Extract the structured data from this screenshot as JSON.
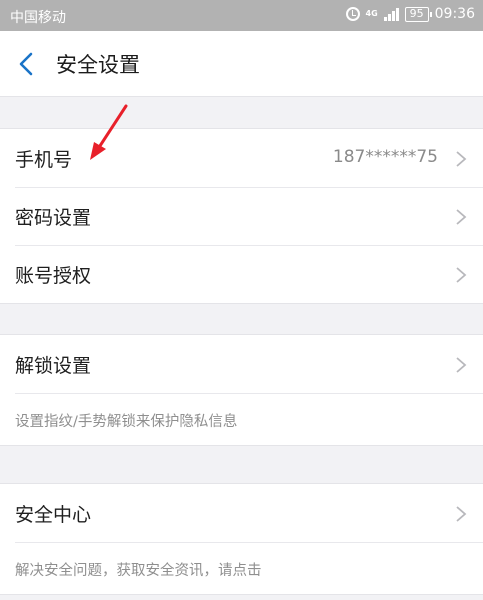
{
  "status_bar": {
    "carrier": "中国移动",
    "network": "4G",
    "battery": "95",
    "time": "09:36"
  },
  "header": {
    "title": "安全设置"
  },
  "groups": [
    {
      "rows": [
        {
          "label": "手机号",
          "value": "187******75"
        },
        {
          "label": "密码设置"
        },
        {
          "label": "账号授权"
        }
      ]
    },
    {
      "rows": [
        {
          "label": "解锁设置"
        }
      ],
      "hint": "设置指纹/手势解锁来保护隐私信息"
    },
    {
      "rows": [
        {
          "label": "安全中心"
        }
      ],
      "hint": "解决安全问题，获取安全资讯，请点击"
    }
  ],
  "colors": {
    "accent": "#1a73c7",
    "annotation_arrow": "#e8202a"
  }
}
